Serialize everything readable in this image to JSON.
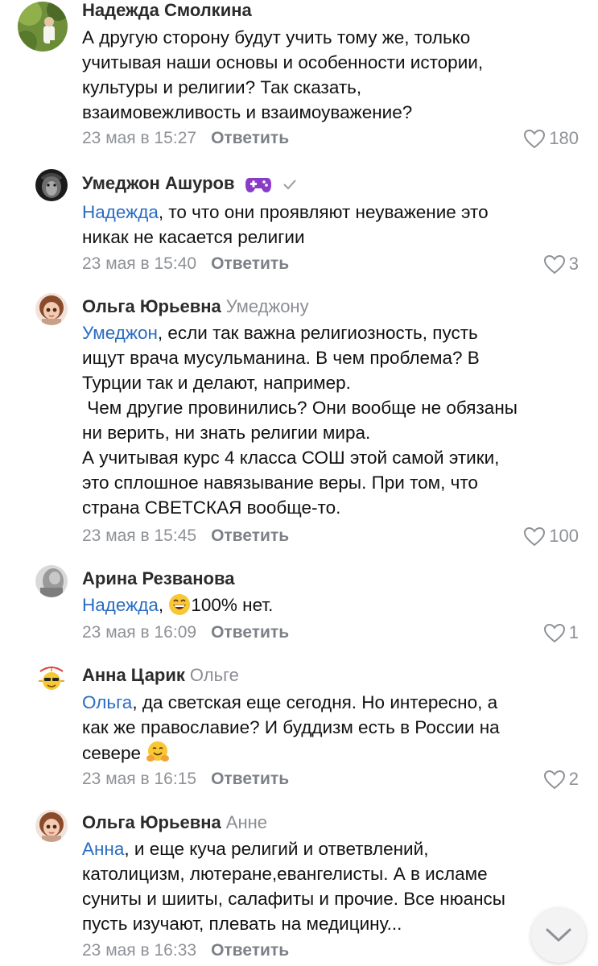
{
  "comments": [
    {
      "author": "Надежда Смолкина",
      "reply_to": "",
      "mention": "",
      "lines": [
        "А другую сторону будут учить тому же, только",
        "учитывая наши основы и особенности истории,",
        "культуры и религии? Так сказать,",
        "взаимовежливость и взаимоуважение?"
      ],
      "date": "23 мая в 15:27",
      "reply_label": "Ответить",
      "likes": "180"
    },
    {
      "author": "Умеджон Ашуров",
      "reply_to": "",
      "mention": "Надежда",
      "first_rest": ", то что они проявляют неуважение это",
      "lines": [
        "никак не касается религии"
      ],
      "date": "23 мая в 15:40",
      "reply_label": "Ответить",
      "likes": "3"
    },
    {
      "author": "Ольга Юрьевна",
      "reply_to": "Умеджону",
      "mention": "Умеджон",
      "first_rest": ", если так важна религиозность, пусть",
      "lines": [
        "ищут врача мусульманина. В чем проблема? В",
        "Турции так и делают, например.",
        " Чем другие провинились? Они вообще не обязаны",
        "ни верить, ни знать религии мира.",
        "А учитывая курс 4 класса СОШ этой самой этики,",
        "это сплошное навязывание веры. При том, что",
        "страна СВЕТСКАЯ вообще-то."
      ],
      "date": "23 мая в 15:45",
      "reply_label": "Ответить",
      "likes": "100"
    },
    {
      "author": "Арина Резванова",
      "reply_to": "",
      "mention": "Надежда",
      "first_rest": "100% нет.",
      "lines": [],
      "date": "23 мая в 16:09",
      "reply_label": "Ответить",
      "likes": "1"
    },
    {
      "author": "Анна Царик",
      "reply_to": "Ольге",
      "mention": "Ольга",
      "first_rest": ", да светская еще сегодня. Но интересно, а",
      "lines": [
        "как же православие? И буддизм есть в России на",
        "севере"
      ],
      "date": "23 мая в 16:15",
      "reply_label": "Ответить",
      "likes": "2"
    },
    {
      "author": "Ольга Юрьевна",
      "reply_to": "Анне",
      "mention": "Анна",
      "first_rest": ", и еще куча религий и ответвлений,",
      "lines": [
        "католицизм, лютеране,евангелисты. А в исламе",
        "суниты и шииты, салафиты и прочие. Все нюансы",
        "пусть изучают, плевать на медицину..."
      ],
      "date": "23 мая в 16:33",
      "reply_label": "Ответить",
      "likes": ""
    }
  ],
  "colors": {
    "mention": "#2a6cc2",
    "meta": "#8e9196",
    "name": "#2b2b2b"
  },
  "icons": {
    "like": "heart-outline-icon",
    "verified": "checkmark-icon",
    "gamepad": "gamepad-emoji-icon",
    "scroll": "chevron-down-icon"
  }
}
